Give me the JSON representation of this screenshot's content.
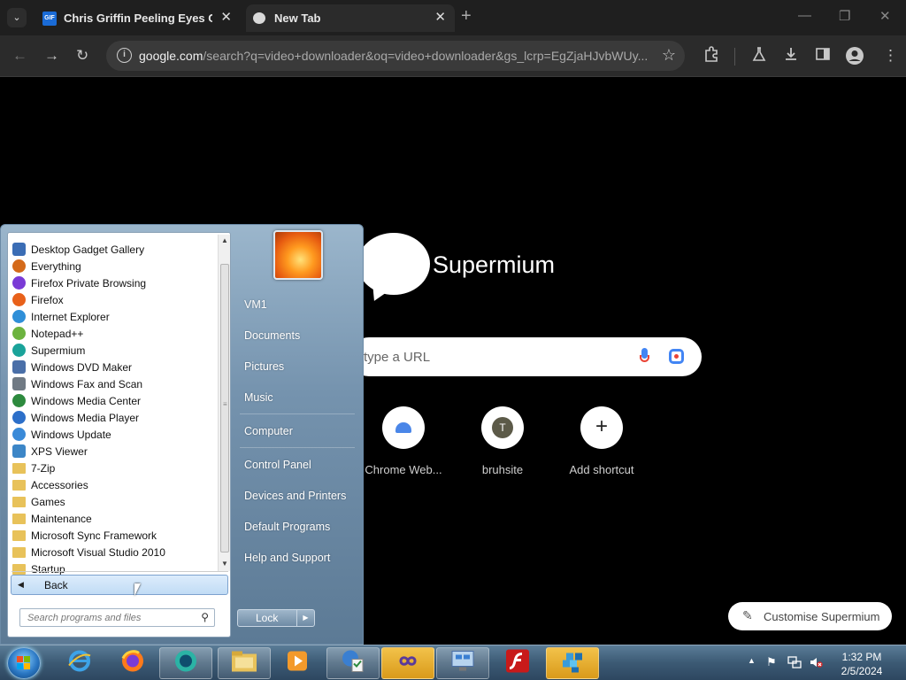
{
  "browser": {
    "tabs": [
      {
        "title": "Chris Griffin Peeling Eyes Out (",
        "favicon": "gif-icon",
        "favicon_text": "GIF",
        "active": false
      },
      {
        "title": "New Tab",
        "favicon": "supermium-icon",
        "active": true
      }
    ],
    "close_glyph": "✕",
    "new_tab_glyph": "+",
    "window_controls": {
      "minimize": "—",
      "restore": "❐",
      "close": "✕"
    },
    "toolbar": {
      "back": "←",
      "forward": "→",
      "reload": "↻",
      "url_host": "google.com",
      "url_rest": "/search?q=video+downloader&oq=video+downloader&gs_lcrp=EgZjaHJvbWUy...",
      "bookmark_star": "☆"
    }
  },
  "ntp": {
    "logo_text": "Supermium",
    "search_placeholder": "type a URL",
    "shortcuts": [
      {
        "label": "Chrome Web...",
        "icon": "webstore-icon"
      },
      {
        "label": "bruhsite",
        "icon": "letter-avatar",
        "letter": "T"
      },
      {
        "label": "Add shortcut",
        "icon": "plus-icon",
        "glyph": "+"
      }
    ],
    "customise_label": "Customise Supermium",
    "customise_icon": "✎"
  },
  "start_menu": {
    "programs": [
      {
        "label": "Desktop Gadget Gallery",
        "icon": "gadget-icon",
        "color": "#3b6db5"
      },
      {
        "label": "Everything",
        "icon": "magnifier-icon",
        "color": "#d46a1a"
      },
      {
        "label": "Firefox Private Browsing",
        "icon": "firefox-private-icon",
        "color": "#7a3bd6"
      },
      {
        "label": "Firefox",
        "icon": "firefox-icon",
        "color": "#e8611a"
      },
      {
        "label": "Internet Explorer",
        "icon": "ie-icon",
        "color": "#2f8fd8"
      },
      {
        "label": "Notepad++",
        "icon": "notepadpp-icon",
        "color": "#6cb33f"
      },
      {
        "label": "Supermium",
        "icon": "supermium-icon",
        "color": "#1aa39a"
      },
      {
        "label": "Windows DVD Maker",
        "icon": "dvd-icon",
        "color": "#4a6fa8"
      },
      {
        "label": "Windows Fax and Scan",
        "icon": "fax-icon",
        "color": "#707a84"
      },
      {
        "label": "Windows Media Center",
        "icon": "media-center-icon",
        "color": "#2d8a3e"
      },
      {
        "label": "Windows Media Player",
        "icon": "media-player-icon",
        "color": "#2c6fc9"
      },
      {
        "label": "Windows Update",
        "icon": "update-icon",
        "color": "#3a8ad8"
      },
      {
        "label": "XPS Viewer",
        "icon": "xps-icon",
        "color": "#3c86c7"
      },
      {
        "label": "7-Zip",
        "icon": "folder-icon",
        "color": "#e8c25a"
      },
      {
        "label": "Accessories",
        "icon": "folder-icon",
        "color": "#e8c25a"
      },
      {
        "label": "Games",
        "icon": "folder-icon",
        "color": "#e8c25a"
      },
      {
        "label": "Maintenance",
        "icon": "folder-icon",
        "color": "#e8c25a"
      },
      {
        "label": "Microsoft Sync Framework",
        "icon": "folder-icon",
        "color": "#e8c25a"
      },
      {
        "label": "Microsoft Visual Studio 2010",
        "icon": "folder-icon",
        "color": "#e8c25a"
      },
      {
        "label": "Startup",
        "icon": "folder-icon",
        "color": "#e8c25a"
      }
    ],
    "back_label": "Back",
    "search_placeholder": "Search programs and files",
    "right_items": [
      "VM1",
      "Documents",
      "Pictures",
      "Music",
      "Computer",
      "Control Panel",
      "Devices and Printers",
      "Default Programs",
      "Help and Support"
    ],
    "lock_label": "Lock"
  },
  "taskbar": {
    "pinned": [
      "internet-explorer-icon",
      "firefox-icon",
      "supermium-icon",
      "explorer-folder-icon",
      "media-player-icon",
      "system-config-icon",
      "infinity-app-icon",
      "network-settings-icon",
      "flash-icon",
      "registry-icon"
    ],
    "time": "1:32 PM",
    "date": "2/5/2024"
  }
}
